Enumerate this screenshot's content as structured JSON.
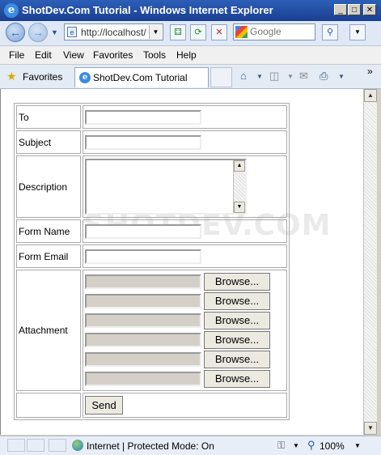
{
  "window": {
    "title": "ShotDev.Com Tutorial - Windows Internet Explorer",
    "minimize": "_",
    "maximize": "□",
    "close": "✕"
  },
  "nav": {
    "address": "http://localhost/",
    "search_placeholder": "Google"
  },
  "menu": {
    "items": [
      "File",
      "Edit",
      "View",
      "Favorites",
      "Tools",
      "Help"
    ]
  },
  "favorites_bar": {
    "favorites_label": "Favorites",
    "tab_label": "ShotDev.Com Tutorial"
  },
  "watermark": "SHOTDEV.COM",
  "form": {
    "to_label": "To",
    "subject_label": "Subject",
    "description_label": "Description",
    "form_name_label": "Form Name",
    "form_email_label": "Form Email",
    "attachment_label": "Attachment",
    "browse_label": "Browse...",
    "send_label": "Send"
  },
  "status": {
    "text": "Internet | Protected Mode: On",
    "zoom": "100%"
  }
}
